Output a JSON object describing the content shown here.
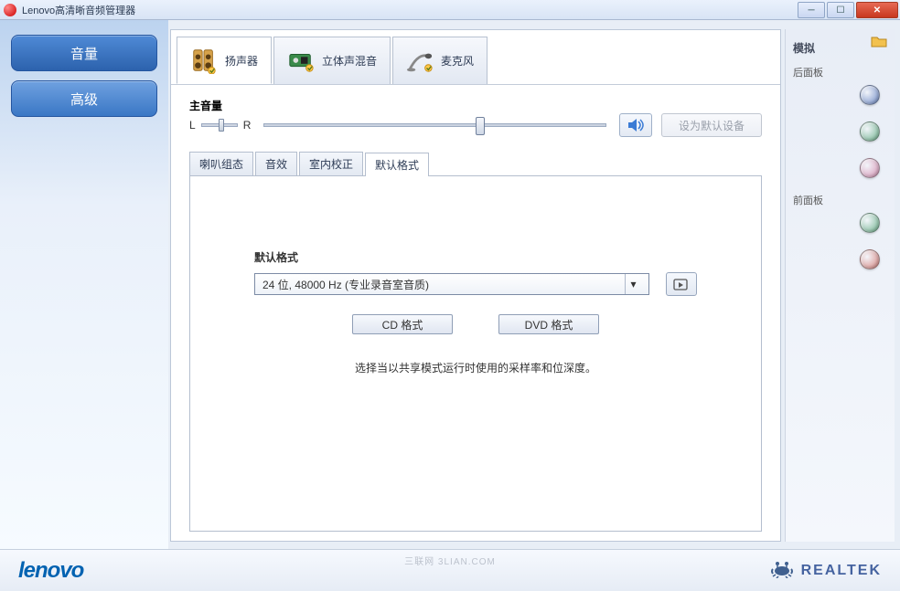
{
  "window": {
    "title": "Lenovo高清晰音频管理器"
  },
  "sidebar": {
    "items": [
      "音量",
      "高级"
    ]
  },
  "device_tabs": [
    {
      "label": "扬声器",
      "icon": "speaker"
    },
    {
      "label": "立体声混音",
      "icon": "mix"
    },
    {
      "label": "麦克风",
      "icon": "mic"
    }
  ],
  "volume": {
    "label": "主音量",
    "balance_left": "L",
    "balance_right": "R",
    "set_default": "设为默认设备"
  },
  "sub_tabs": [
    "喇叭组态",
    "音效",
    "室内校正",
    "默认格式"
  ],
  "default_format": {
    "title": "默认格式",
    "selected": "24 位, 48000 Hz (专业录音室音质)",
    "cd_btn": "CD 格式",
    "dvd_btn": "DVD 格式",
    "hint": "选择当以共享模式运行时使用的采样率和位深度。"
  },
  "jack_panel": {
    "title": "模拟",
    "back_label": "后面板",
    "front_label": "前面板",
    "back_jacks": [
      "#6a86c4",
      "#6bb08a",
      "#d38fb1"
    ],
    "front_jacks": [
      "#6bb08a",
      "#d37f7a"
    ]
  },
  "footer": {
    "lenovo": "lenovo",
    "realtek": "REALTEK"
  },
  "watermark": "三联网  3LIAN.COM"
}
